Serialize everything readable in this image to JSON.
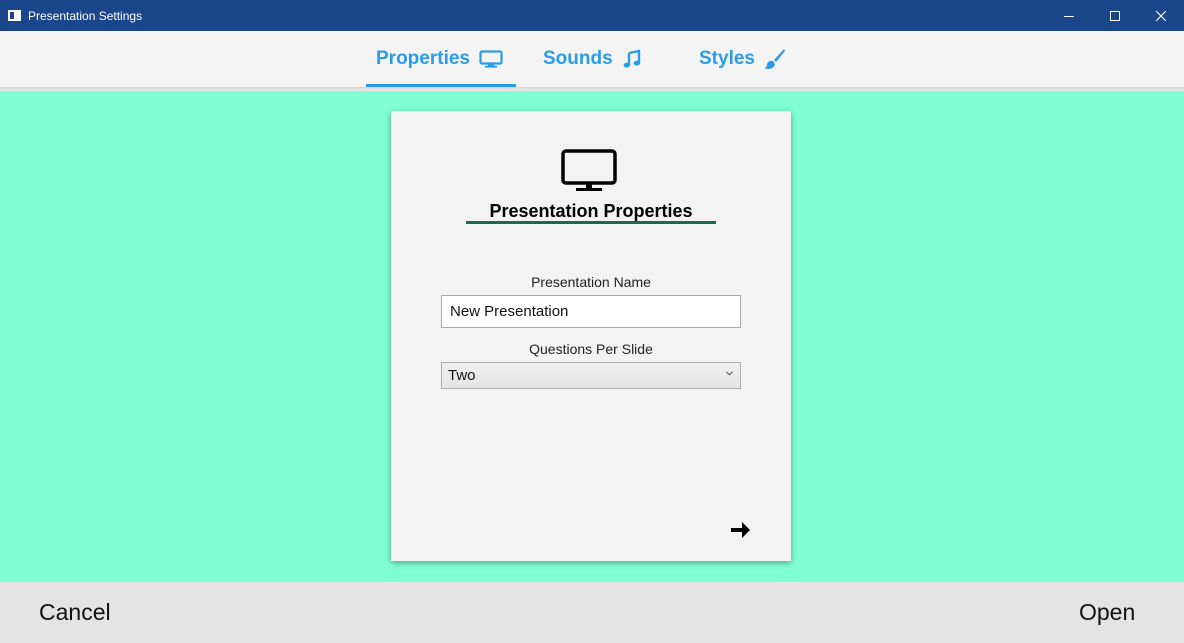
{
  "window": {
    "title": "Presentation Settings",
    "controls": [
      "minimize-icon",
      "maximize-icon",
      "close-icon"
    ]
  },
  "tabs": [
    {
      "label": "Properties",
      "icon": "monitor-icon",
      "active": true
    },
    {
      "label": "Sounds",
      "icon": "music-note-icon",
      "active": false
    },
    {
      "label": "Styles",
      "icon": "paintbrush-icon",
      "active": false
    }
  ],
  "card": {
    "icon": "monitor-icon",
    "title": "Presentation Properties",
    "name_label": "Presentation Name",
    "name_value": "New Presentation",
    "qps_label": "Questions Per Slide",
    "qps_value": "Two",
    "next_icon": "arrow-right-icon"
  },
  "footer": {
    "cancel_label": "Cancel",
    "open_label": "Open"
  },
  "colors": {
    "titlebar": "#1a478c",
    "accent": "#2b9be8",
    "background": "#80ffd4",
    "underline": "#1b6a4a"
  }
}
